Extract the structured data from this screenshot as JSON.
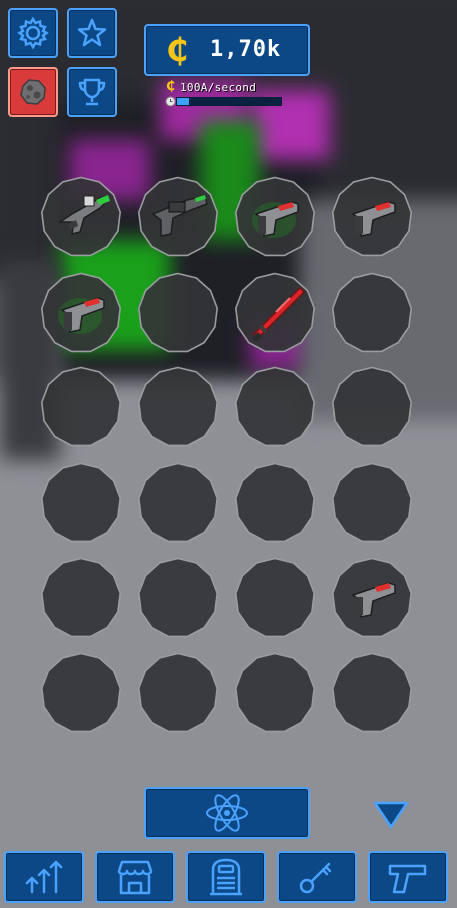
{
  "header": {
    "currency_symbol": "₵",
    "currency_value": "1,70k",
    "rate_symbol": "₵",
    "rate_text": "100A/second",
    "rate_progress": 0.12
  },
  "top_buttons": [
    {
      "name": "settings",
      "icon": "gear-icon"
    },
    {
      "name": "favorites",
      "icon": "star-icon"
    },
    {
      "name": "asteroid",
      "icon": "asteroid-icon",
      "active": true
    },
    {
      "name": "achievements",
      "icon": "trophy-icon"
    }
  ],
  "grid": {
    "rows": 6,
    "cols": 4,
    "slots": [
      {
        "item": "green-blaster"
      },
      {
        "item": "heavy-blaster"
      },
      {
        "item": "red-pistol-glow"
      },
      {
        "item": "red-pistol"
      },
      {
        "item": "red-pistol-glow"
      },
      {
        "item": null
      },
      {
        "item": "red-saber"
      },
      {
        "item": null
      },
      {
        "item": null
      },
      {
        "item": null
      },
      {
        "item": null
      },
      {
        "item": null
      },
      {
        "item": null
      },
      {
        "item": null
      },
      {
        "item": null
      },
      {
        "item": null
      },
      {
        "item": null
      },
      {
        "item": null
      },
      {
        "item": null
      },
      {
        "item": "red-pistol"
      },
      {
        "item": null
      },
      {
        "item": null
      },
      {
        "item": null
      },
      {
        "item": null
      }
    ]
  },
  "action_button": {
    "icon": "atom-icon"
  },
  "scroll_indicator": {
    "icon": "triangle-down-icon"
  },
  "bottom_nav": [
    {
      "name": "upgrades",
      "icon": "arrows-up-icon"
    },
    {
      "name": "shop",
      "icon": "store-icon"
    },
    {
      "name": "robot",
      "icon": "robot-icon"
    },
    {
      "name": "key",
      "icon": "key-icon"
    },
    {
      "name": "weapons",
      "icon": "pistol-icon"
    }
  ],
  "colors": {
    "button_fill": "#0c4886",
    "button_border": "#4aa2ff",
    "active_button": "#d93a3a",
    "coin": "#f5c518",
    "slot_fill": "#333436",
    "slot_border": "#9a9ca0"
  }
}
